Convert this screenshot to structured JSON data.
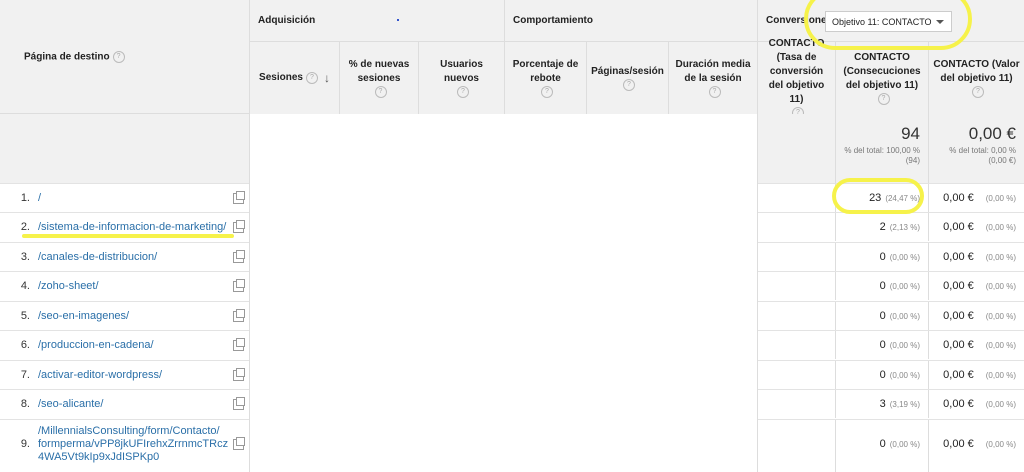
{
  "table": {
    "dimension_header": "Página de destino",
    "groups": {
      "acquisition": "Adquisición",
      "behavior": "Comportamiento",
      "conversions": "Conversiones"
    },
    "goal_select": "Objetivo 11: CONTACTO",
    "columns": {
      "sessions": "Sesiones",
      "new_sessions": "% de nuevas sesiones",
      "new_users": "Usuarios nuevos",
      "bounce": "Porcentaje de rebote",
      "pages_session": "Páginas/sesión",
      "duration": "Duración media de la sesión",
      "conv_rate": "CONTACTO (Tasa de conversión del objetivo 11)",
      "completions": "CONTACTO (Consecuciones del objetivo 11)",
      "value": "CONTACTO (Valor del objetivo 11)"
    },
    "totals": {
      "completions": "94",
      "completions_note": "% del total: 100,00 % (94)",
      "value": "0,00 €",
      "value_note": "% del total: 0,00 % (0,00 €)"
    },
    "rows": [
      {
        "n": "1.",
        "page": "/",
        "completions": "23",
        "completions_pct": "(24,47 %)",
        "value": "0,00 €",
        "value_pct": "(0,00 %)"
      },
      {
        "n": "2.",
        "page": "/sistema-de-informacion-de-marketing/",
        "completions": "2",
        "completions_pct": "(2,13 %)",
        "value": "0,00 €",
        "value_pct": "(0,00 %)"
      },
      {
        "n": "3.",
        "page": "/canales-de-distribucion/",
        "completions": "0",
        "completions_pct": "(0,00 %)",
        "value": "0,00 €",
        "value_pct": "(0,00 %)"
      },
      {
        "n": "4.",
        "page": "/zoho-sheet/",
        "completions": "0",
        "completions_pct": "(0,00 %)",
        "value": "0,00 €",
        "value_pct": "(0,00 %)"
      },
      {
        "n": "5.",
        "page": "/seo-en-imagenes/",
        "completions": "0",
        "completions_pct": "(0,00 %)",
        "value": "0,00 €",
        "value_pct": "(0,00 %)"
      },
      {
        "n": "6.",
        "page": "/produccion-en-cadena/",
        "completions": "0",
        "completions_pct": "(0,00 %)",
        "value": "0,00 €",
        "value_pct": "(0,00 %)"
      },
      {
        "n": "7.",
        "page": "/activar-editor-wordpress/",
        "completions": "0",
        "completions_pct": "(0,00 %)",
        "value": "0,00 €",
        "value_pct": "(0,00 %)"
      },
      {
        "n": "8.",
        "page": "/seo-alicante/",
        "completions": "3",
        "completions_pct": "(3,19 %)",
        "value": "0,00 €",
        "value_pct": "(0,00 %)"
      },
      {
        "n": "9.",
        "page_lines": [
          "/MillennialsConsulting/form/Contacto/",
          "formperma/vPP8jkUFIrehxZrrnmcTRcz",
          "4WA5Vt9kIp9xJdISPKp0"
        ],
        "completions": "0",
        "completions_pct": "(0,00 %)",
        "value": "0,00 €",
        "value_pct": "(0,00 %)"
      }
    ]
  },
  "colors": {
    "link": "#2a6fa8",
    "highlight": "#f6f24a",
    "header_bg": "#f1f1f1"
  }
}
